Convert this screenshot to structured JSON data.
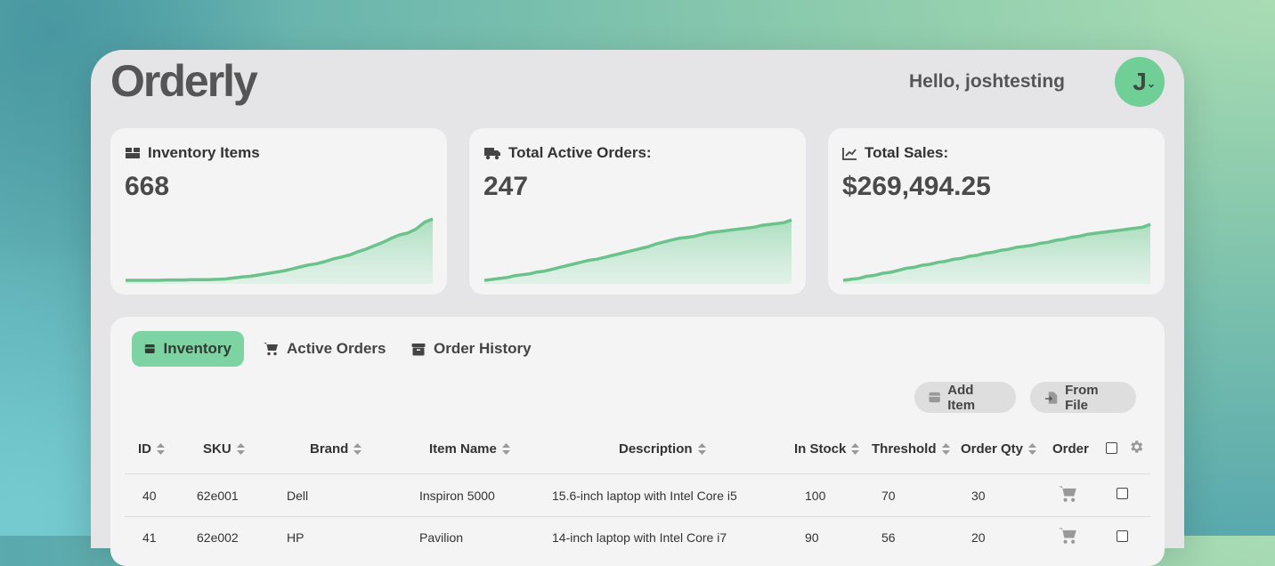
{
  "app": {
    "logo": "Orderly",
    "greeting": "Hello, joshtesting",
    "avatar_initial": "J"
  },
  "cards": [
    {
      "title": "Inventory Items",
      "value": "668",
      "icon": "boxes-icon",
      "trend": [
        0,
        0,
        0,
        0,
        0,
        0.5,
        0.5,
        0.5,
        1,
        1,
        1,
        1.5,
        2,
        3.5,
        5,
        6,
        8,
        10,
        12,
        14,
        17,
        20,
        23,
        25,
        28,
        32,
        35,
        38,
        43,
        47,
        52,
        57,
        63,
        68,
        71,
        77,
        87,
        92
      ],
      "trend_max": 96
    },
    {
      "title": "Total Active Orders:",
      "value": "247",
      "icon": "truck-icon",
      "trend": [
        0,
        1,
        2,
        3,
        5,
        6,
        7,
        9,
        10,
        12,
        14,
        16,
        18,
        20,
        22,
        23,
        25,
        27,
        29,
        31,
        33,
        35,
        37,
        40,
        42,
        44,
        46,
        47,
        48,
        50,
        52,
        53,
        54,
        55,
        56,
        57,
        58,
        60,
        61,
        62,
        63,
        66
      ],
      "trend_max": 70
    },
    {
      "title": "Total Sales:",
      "value": "$269,494.25",
      "icon": "chart-line-icon",
      "trend": [
        0,
        1,
        2,
        4,
        5,
        7,
        8,
        10,
        12,
        13,
        15,
        16,
        18,
        19,
        21,
        22,
        24,
        25,
        27,
        28,
        30,
        31,
        33,
        34,
        35,
        37,
        38,
        40,
        41,
        43,
        44,
        46,
        47,
        48,
        49,
        50,
        51,
        52,
        53,
        56
      ],
      "trend_max": 64
    }
  ],
  "tabs": [
    {
      "label": "Inventory",
      "icon": "box-icon",
      "active": true
    },
    {
      "label": "Active Orders",
      "icon": "cart-icon",
      "active": false
    },
    {
      "label": "Order History",
      "icon": "archive-icon",
      "active": false
    }
  ],
  "actions": {
    "add_item": "Add Item",
    "from_file": "From File"
  },
  "table": {
    "headers": [
      "ID",
      "SKU",
      "Brand",
      "Item Name",
      "Description",
      "In Stock",
      "Threshold",
      "Order Qty",
      "Order"
    ],
    "rows": [
      {
        "id": "40",
        "sku": "62e001",
        "brand": "Dell",
        "name": "Inspiron 5000",
        "description": "15.6-inch laptop with Intel Core i5",
        "in_stock": "100",
        "threshold": "70",
        "order_qty": "30"
      },
      {
        "id": "41",
        "sku": "62e002",
        "brand": "HP",
        "name": "Pavilion",
        "description": "14-inch laptop with Intel Core i7",
        "in_stock": "90",
        "threshold": "56",
        "order_qty": "20"
      }
    ]
  },
  "colors": {
    "accent": "#7dd3a1",
    "spark_line": "#6cc28b",
    "text": "#4a4a4a"
  }
}
